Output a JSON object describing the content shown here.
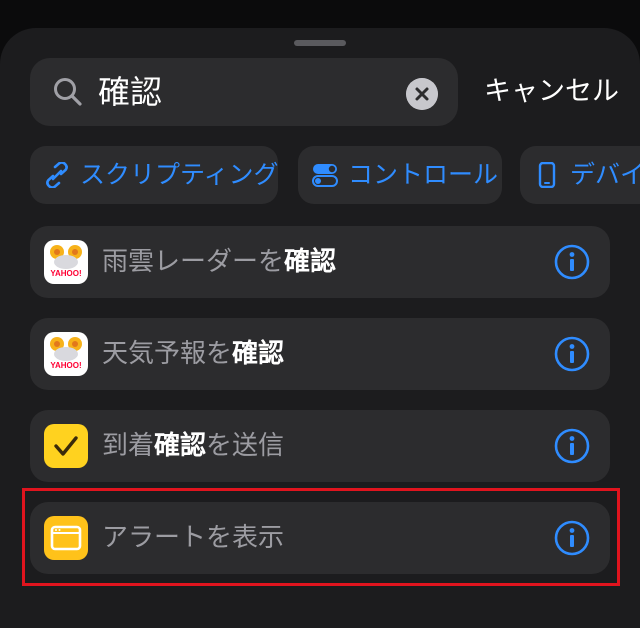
{
  "search": {
    "query": "確認",
    "cancel_label": "キャンセル"
  },
  "categories": [
    {
      "label": "スクリプティング",
      "icon": "link-icon"
    },
    {
      "label": "コントロール",
      "icon": "toggle-icon"
    },
    {
      "label": "デバイス",
      "icon": "phone-icon"
    }
  ],
  "actions": [
    {
      "prefix": "雨雲レーダーを",
      "match": "確認",
      "suffix": "",
      "icon": "yahoo-weather-icon",
      "icon_text": "YAHOO!"
    },
    {
      "prefix": "天気予報を",
      "match": "確認",
      "suffix": "",
      "icon": "yahoo-weather-icon",
      "icon_text": "YAHOO!"
    },
    {
      "prefix": "到着",
      "match": "確認",
      "suffix": "を送信",
      "icon": "checkmark-icon"
    },
    {
      "prefix": "アラートを表示",
      "match": "",
      "suffix": "",
      "icon": "alert-window-icon"
    }
  ],
  "colors": {
    "accent": "#2f8cff",
    "highlight": "#e0141e",
    "row_bg": "#2c2c2e"
  }
}
